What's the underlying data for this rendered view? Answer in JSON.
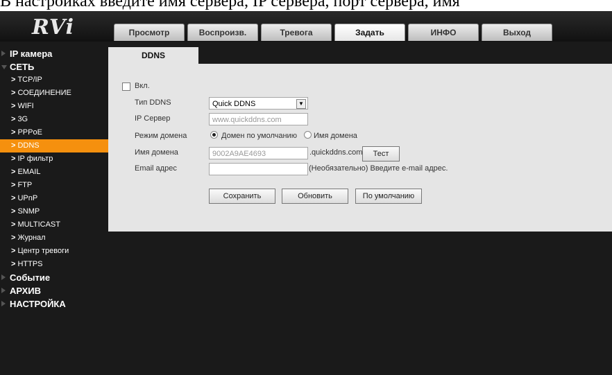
{
  "caption": "В настройках введите имя сервера, IP сервера, порт сервера, имя",
  "logo": "RVi",
  "tabs": [
    "Просмотр",
    "Воспроизв.",
    "Тревога",
    "Задать",
    "ИНФО",
    "Выход"
  ],
  "active_tab": "Задать",
  "sidebar": {
    "ip_camera": "IP камера",
    "network": "СЕТЬ",
    "items": [
      "TCP/IP",
      "СОЕДИНЕНИЕ",
      "WIFI",
      "3G",
      "PPPoE",
      "DDNS",
      "IP фильтр",
      "EMAIL",
      "FTP",
      "UPnP",
      "SNMP",
      "MULTICAST",
      "Журнал",
      "Центр тревоги",
      "HTTPS"
    ],
    "selected": "DDNS",
    "event": "Событие",
    "archive": "АРХИВ",
    "settings": "НАСТРОЙКА"
  },
  "content": {
    "tab_label": "DDNS",
    "enable_label": "Вкл.",
    "ddns_type_label": "Тип DDNS",
    "ddns_type_value": "Quick DDNS",
    "ip_server_label": "IP Сервер",
    "ip_server_placeholder": "www.quickddns.com",
    "domain_mode_label": "Режим домена",
    "domain_default_label": "Домен по умолчанию",
    "domain_name_option": "Имя домена",
    "domain_name_label": "Имя домена",
    "domain_name_value": "9002A9AE4693",
    "domain_suffix": ".quickddns.com",
    "test_button": "Тест",
    "email_label": "Email адрес",
    "email_hint": "(Необязательно) Введите e-mail адрес.",
    "save_button": "Сохранить",
    "refresh_button": "Обновить",
    "default_button": "По умолчанию"
  }
}
